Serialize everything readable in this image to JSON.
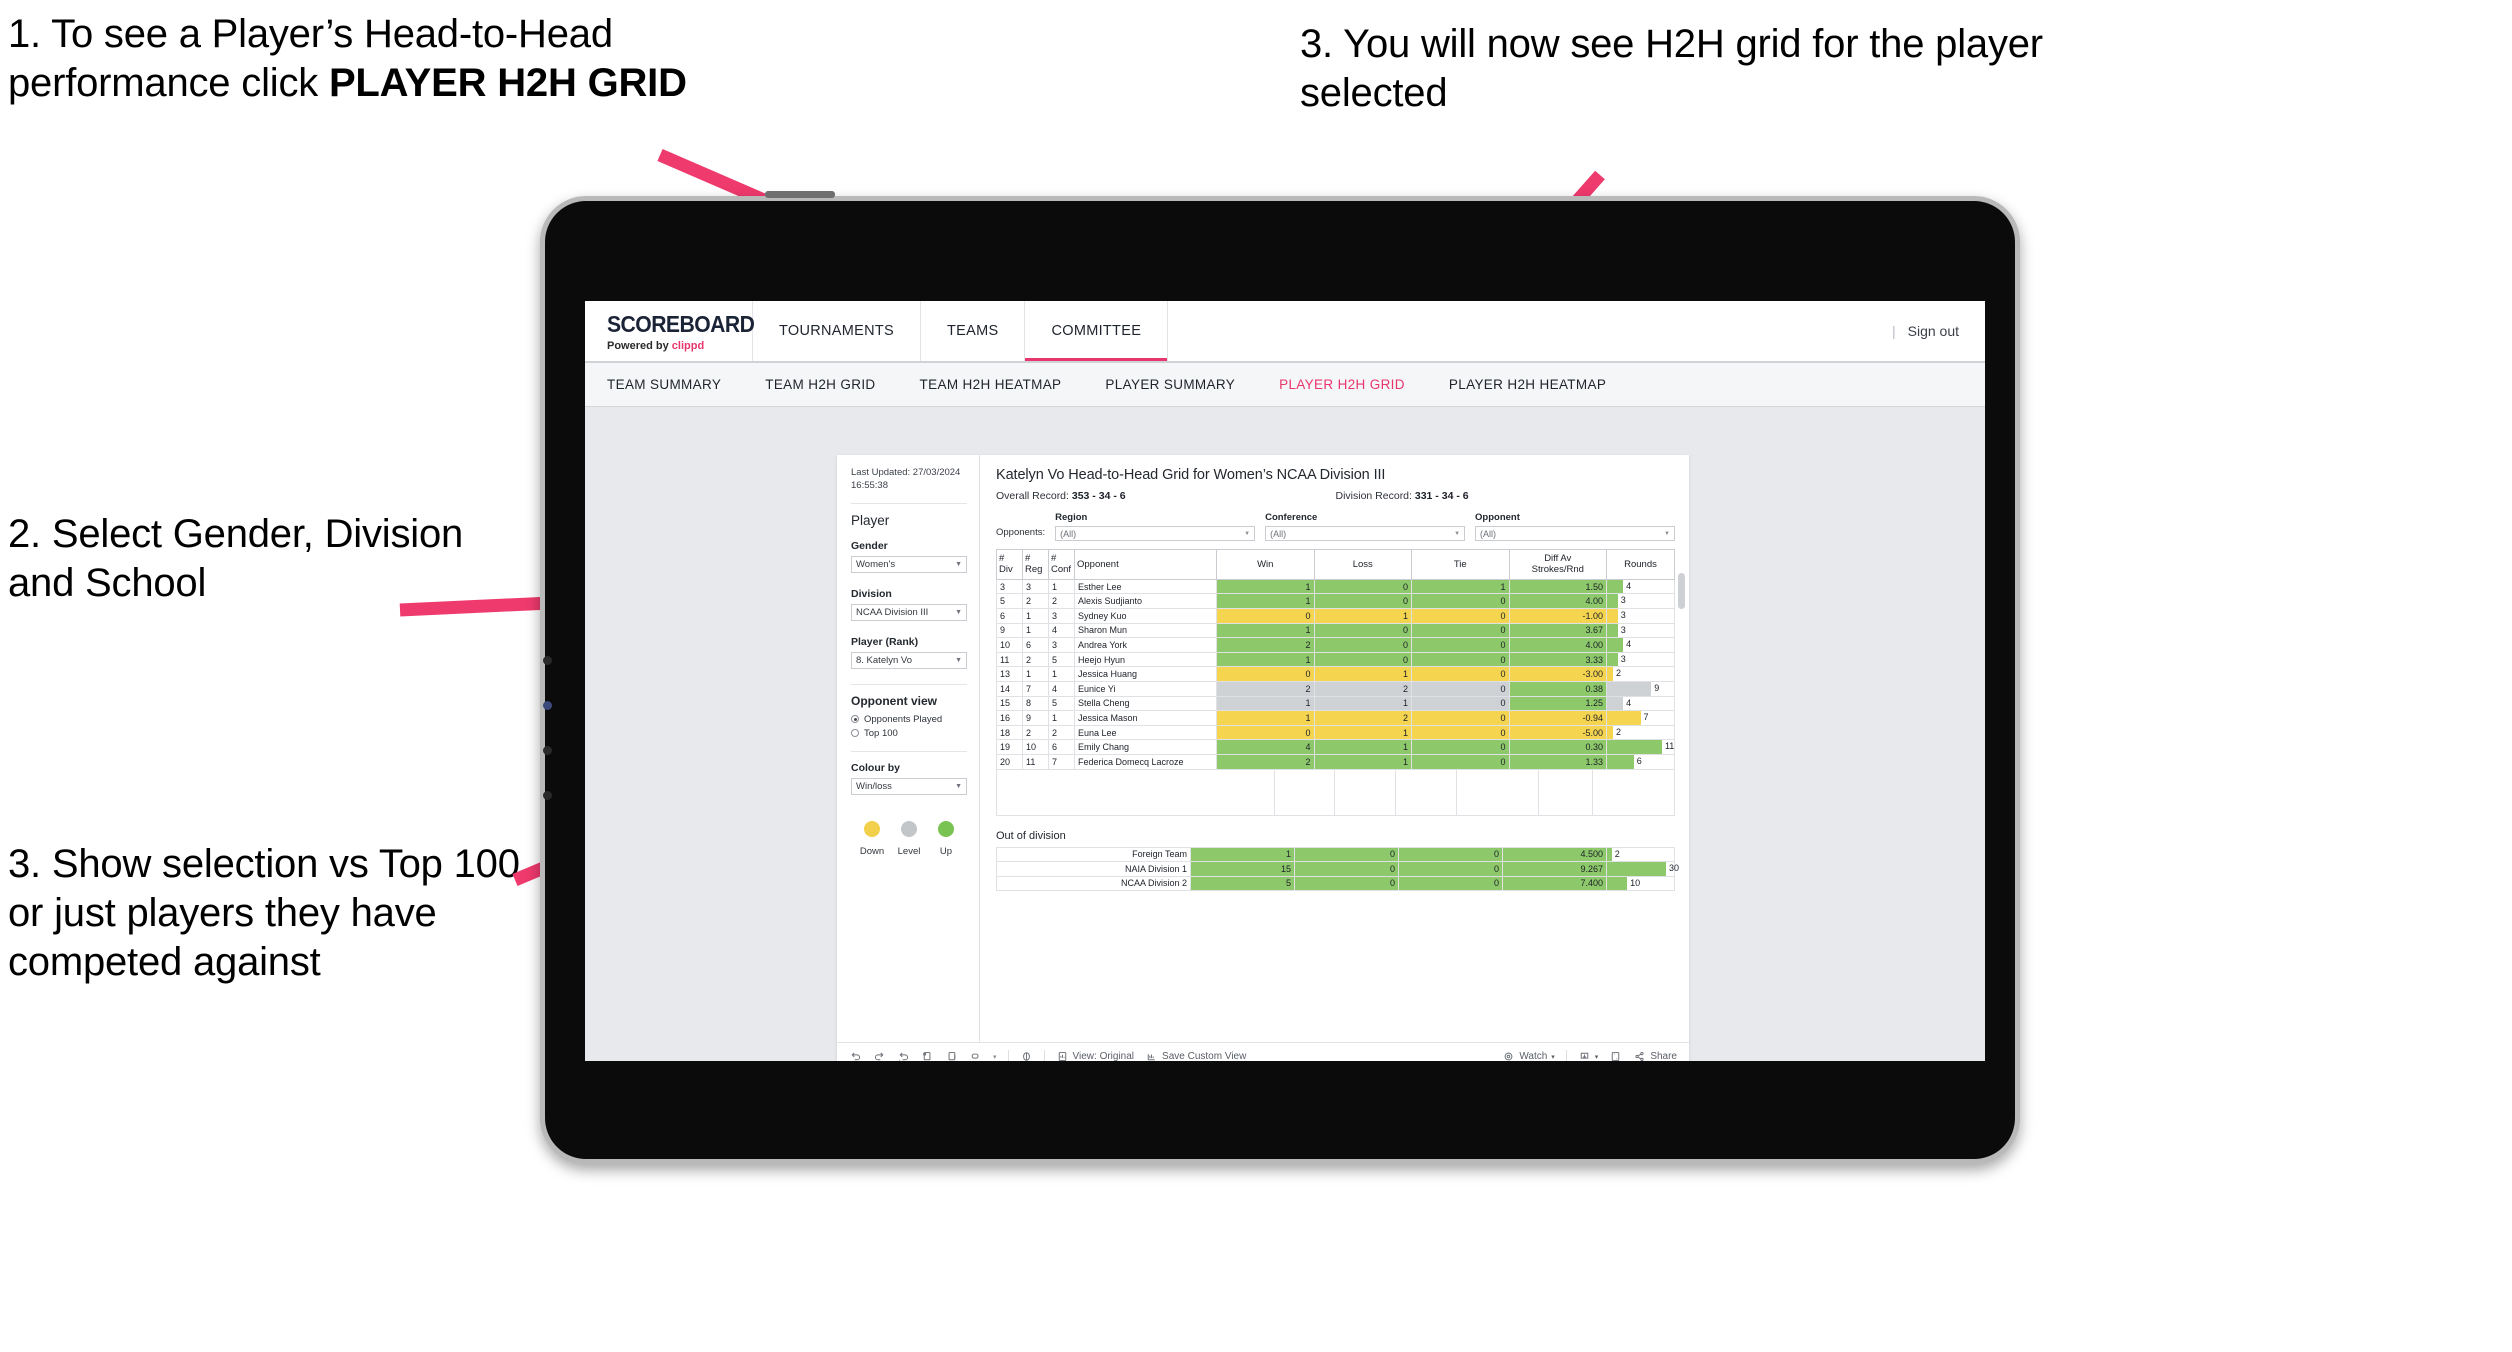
{
  "annotations": {
    "step1_line1": "1. To see a Player’s Head-to-Head performance click ",
    "step1_bold": "PLAYER H2H GRID",
    "step2": "2. Select Gender, Division and School",
    "step3_left": "3. Show selection vs Top 100 or just players they have competed against",
    "step3_right": "3. You will now see H2H grid for the player selected",
    "arrow_color": "#ef3a6e"
  },
  "app": {
    "logo_main": "SCOREBOARD",
    "logo_sub_prefix": "Powered by ",
    "logo_sub_brand": "clippd",
    "nav": [
      {
        "label": "TOURNAMENTS"
      },
      {
        "label": "TEAMS"
      },
      {
        "label": "COMMITTEE"
      }
    ],
    "header_right": {
      "divider": "|",
      "sign_out": "Sign out"
    },
    "tabs": [
      {
        "label": "TEAM SUMMARY",
        "active": false
      },
      {
        "label": "TEAM H2H GRID",
        "active": false
      },
      {
        "label": "TEAM H2H HEATMAP",
        "active": false
      },
      {
        "label": "PLAYER SUMMARY",
        "active": false
      },
      {
        "label": "PLAYER H2H GRID",
        "active": true
      },
      {
        "label": "PLAYER H2H HEATMAP",
        "active": false
      }
    ],
    "accent_color": "#e8366d"
  },
  "filters": {
    "last_updated_line1": "Last Updated: 27/03/2024",
    "last_updated_line2": "16:55:38",
    "panel_title": "Player",
    "gender": {
      "label": "Gender",
      "value": "Women's"
    },
    "division": {
      "label": "Division",
      "value": "NCAA Division III"
    },
    "player": {
      "label": "Player (Rank)",
      "value": "8. Katelyn Vo"
    },
    "opponent_view": {
      "title": "Opponent view",
      "options": [
        {
          "label": "Opponents Played",
          "selected": true
        },
        {
          "label": "Top 100",
          "selected": false
        }
      ]
    },
    "colour_by": {
      "label": "Colour by",
      "value": "Win/loss"
    },
    "legend": [
      {
        "label": "Down",
        "color": "#f2d04b"
      },
      {
        "label": "Level",
        "color": "#c3c6c9"
      },
      {
        "label": "Up",
        "color": "#79c352"
      }
    ]
  },
  "viz": {
    "title": "Katelyn Vo Head-to-Head Grid for Women’s NCAA Division III",
    "overall_record_label": "Overall Record:",
    "overall_record_value": "353 -  34 - 6",
    "division_record_label": "Division Record:",
    "division_record_value": "331 -  34 - 6",
    "opponents_label": "Opponents:",
    "opponent_filters": [
      {
        "label": "Region",
        "value": "(All)"
      },
      {
        "label": "Conference",
        "value": "(All)"
      },
      {
        "label": "Opponent",
        "value": "(All)"
      }
    ],
    "columns": [
      "#\nDiv",
      "#\nReg",
      "#\nConf",
      "Opponent",
      "Win",
      "Loss",
      "Tie",
      "Diff Av\nStrokes/Rnd",
      "Rounds"
    ],
    "column_labels": {
      "div_a": "#",
      "div_b": "Div",
      "reg_a": "#",
      "reg_b": "Reg",
      "conf_a": "#",
      "conf_b": "Conf",
      "opponent": "Opponent",
      "win": "Win",
      "loss": "Loss",
      "tie": "Tie",
      "diff_a": "Diff Av",
      "diff_b": "Strokes/Rnd",
      "rounds": "Rounds"
    },
    "rows": [
      {
        "div": "3",
        "reg": "3",
        "conf": "1",
        "opponent": "Esther Lee",
        "win": "1",
        "loss": "0",
        "tie": "1",
        "diff": "1.50",
        "rounds": "4",
        "color": "#8dc96a",
        "bar_pct": 24
      },
      {
        "div": "5",
        "reg": "2",
        "conf": "2",
        "opponent": "Alexis Sudjianto",
        "win": "1",
        "loss": "0",
        "tie": "0",
        "diff": "4.00",
        "rounds": "3",
        "color": "#8dc96a",
        "bar_pct": 16
      },
      {
        "div": "6",
        "reg": "1",
        "conf": "3",
        "opponent": "Sydney Kuo",
        "win": "0",
        "loss": "1",
        "tie": "0",
        "diff": "-1.00",
        "rounds": "3",
        "color": "#f5d44f",
        "bar_pct": 16
      },
      {
        "div": "9",
        "reg": "1",
        "conf": "4",
        "opponent": "Sharon Mun",
        "win": "1",
        "loss": "0",
        "tie": "0",
        "diff": "3.67",
        "rounds": "3",
        "color": "#8dc96a",
        "bar_pct": 16
      },
      {
        "div": "10",
        "reg": "6",
        "conf": "3",
        "opponent": "Andrea York",
        "win": "2",
        "loss": "0",
        "tie": "0",
        "diff": "4.00",
        "rounds": "4",
        "color": "#8dc96a",
        "bar_pct": 24
      },
      {
        "div": "11",
        "reg": "2",
        "conf": "5",
        "opponent": "Heejo Hyun",
        "win": "1",
        "loss": "0",
        "tie": "0",
        "diff": "3.33",
        "rounds": "3",
        "color": "#8dc96a",
        "bar_pct": 16
      },
      {
        "div": "13",
        "reg": "1",
        "conf": "1",
        "opponent": "Jessica Huang",
        "win": "0",
        "loss": "1",
        "tie": "0",
        "diff": "-3.00",
        "rounds": "2",
        "color": "#f5d44f",
        "bar_pct": 9
      },
      {
        "div": "14",
        "reg": "7",
        "conf": "4",
        "opponent": "Eunice Yi",
        "win": "2",
        "loss": "2",
        "tie": "0",
        "diff": "0.38",
        "rounds": "9",
        "color": "#cfd2d5",
        "bar_pct": 66,
        "diff_color": "#8dc96a"
      },
      {
        "div": "15",
        "reg": "8",
        "conf": "5",
        "opponent": "Stella Cheng",
        "win": "1",
        "loss": "1",
        "tie": "0",
        "diff": "1.25",
        "rounds": "4",
        "color": "#cfd2d5",
        "bar_pct": 24,
        "diff_color": "#8dc96a"
      },
      {
        "div": "16",
        "reg": "9",
        "conf": "1",
        "opponent": "Jessica Mason",
        "win": "1",
        "loss": "2",
        "tie": "0",
        "diff": "-0.94",
        "rounds": "7",
        "color": "#f5d44f",
        "bar_pct": 50
      },
      {
        "div": "18",
        "reg": "2",
        "conf": "2",
        "opponent": "Euna Lee",
        "win": "0",
        "loss": "1",
        "tie": "0",
        "diff": "-5.00",
        "rounds": "2",
        "color": "#f5d44f",
        "bar_pct": 9
      },
      {
        "div": "19",
        "reg": "10",
        "conf": "6",
        "opponent": "Emily Chang",
        "win": "4",
        "loss": "1",
        "tie": "0",
        "diff": "0.30",
        "rounds": "11",
        "color": "#8dc96a",
        "bar_pct": 82
      },
      {
        "div": "20",
        "reg": "11",
        "conf": "7",
        "opponent": "Federica Domecq Lacroze",
        "win": "2",
        "loss": "1",
        "tie": "0",
        "diff": "1.33",
        "rounds": "6",
        "color": "#8dc96a",
        "bar_pct": 40
      }
    ],
    "out_of_division": {
      "title": "Out of division",
      "rows": [
        {
          "name": "Foreign Team",
          "win": "1",
          "loss": "0",
          "tie": "0",
          "diff": "4.500",
          "rounds": "2",
          "color": "#8dc96a",
          "bar_pct": 7
        },
        {
          "name": "NAIA Division 1",
          "win": "15",
          "loss": "0",
          "tie": "0",
          "diff": "9.267",
          "rounds": "30",
          "color": "#8dc96a",
          "bar_pct": 88
        },
        {
          "name": "NCAA Division 2",
          "win": "5",
          "loss": "0",
          "tie": "0",
          "diff": "7.400",
          "rounds": "10",
          "color": "#8dc96a",
          "bar_pct": 30
        }
      ]
    }
  },
  "toolbar": {
    "view_label": "View: Original",
    "save_label": "Save Custom View",
    "watch_label": "Watch",
    "share_label": "Share",
    "caret": "▾"
  }
}
